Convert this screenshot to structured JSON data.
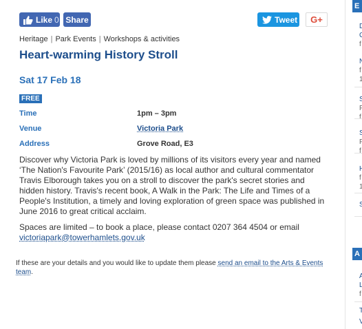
{
  "share": {
    "like_label": "Like",
    "like_count": "0",
    "share_label": "Share",
    "tweet_label": "Tweet",
    "gplus_label": "G+"
  },
  "breadcrumb": [
    "Heritage",
    "Park Events",
    "Workshops & activities"
  ],
  "event": {
    "title": "Heart-warming History Stroll",
    "date": "Sat 17 Feb 18",
    "price_badge": "FREE",
    "details": [
      {
        "label": "Time",
        "value": "1pm – 3pm"
      },
      {
        "label": "Venue",
        "value": "Victoria Park"
      },
      {
        "label": "Address",
        "value": "Grove Road, E3"
      }
    ],
    "description": "Discover why Victoria Park is loved by millions of its visitors every year and named ‘The Nation's Favourite Park’ (2015/16) as local author and cultural commentator Travis Elborough takes you on a stroll to discover the park's secret stories and hidden history. Travis's recent book, A Walk in the Park: The Life and Times of a People's Institution, a timely and loving exploration of green space was published in June 2016 to great critical acclaim.",
    "booking_text": "Spaces are limited – to book a place, please contact 0207 364 4504 or email",
    "booking_email": "victoriapark@towerhamlets.gov.uk"
  },
  "update_note": {
    "text": "If these are your details and you would like to update them please",
    "link": "send an email to the Arts & Events team",
    "suffix": "."
  },
  "sidebar": {
    "head_top": "E",
    "head_bottom": "A",
    "chars": [
      {
        "t": "D",
        "grey": false
      },
      {
        "t": "C",
        "grey": false
      },
      {
        "t": "f",
        "grey": true
      },
      {
        "t": "N",
        "grey": false
      },
      {
        "t": "f",
        "grey": true
      },
      {
        "t": "1",
        "grey": true
      },
      {
        "t": "S",
        "grey": false
      },
      {
        "t": "F",
        "grey": true
      },
      {
        "t": "f",
        "grey": true
      },
      {
        "t": "S",
        "grey": false
      },
      {
        "t": "F",
        "grey": true
      },
      {
        "t": "f",
        "grey": true
      },
      {
        "t": "H",
        "grey": false
      },
      {
        "t": "f",
        "grey": true
      },
      {
        "t": "1",
        "grey": true
      },
      {
        "t": "S",
        "grey": false
      },
      {
        "t": "A",
        "grey": false
      },
      {
        "t": "L",
        "grey": false
      },
      {
        "t": "f",
        "grey": true
      },
      {
        "t": "T",
        "grey": false
      },
      {
        "t": "V",
        "grey": false
      }
    ]
  }
}
